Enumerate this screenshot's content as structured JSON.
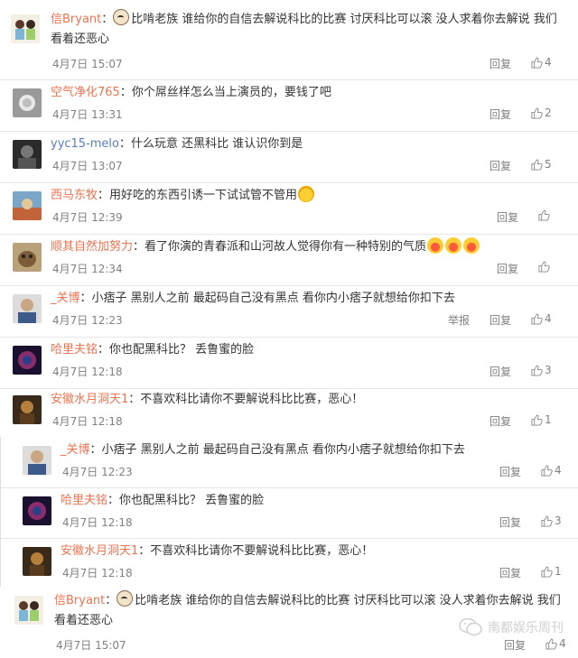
{
  "reply_label": "回复",
  "report_label": "举报",
  "watermark": "南都娱乐周刊",
  "comments": [
    {
      "user": "信Bryant",
      "colon": "：",
      "text": "比啃老族 谁给你的自信去解说科比的比赛 讨厌科比可以滚 没人求着你去解说 我们",
      "text2": "看着还恶心",
      "time": "4月7日 15:07",
      "likes": "4"
    },
    {
      "user": "空气净化765",
      "colon": "：",
      "text": "你个屌丝样怎么当上演员的，要钱了吧",
      "time": "4月7日 13:31",
      "likes": "2"
    },
    {
      "user": "yyc15-melo",
      "colon": "：",
      "text": "什么玩意 还黑科比 谁认识你到是",
      "time": "4月7日 13:07",
      "likes": "5"
    },
    {
      "user": "西马东牧",
      "colon": "：",
      "text": "用好吃的东西引诱一下试试管不管用",
      "time": "4月7日 12:39",
      "likes": ""
    },
    {
      "user": "顺其自然加努力",
      "colon": "：",
      "text": "看了你演的青春派和山河故人觉得你有一种特别的气质",
      "time": "4月7日 12:34",
      "likes": ""
    },
    {
      "user": "_关博",
      "colon": "：",
      "text": "小痞子  黑别人之前  最起码自己没有黑点 看你内小痞子就想给你扣下去",
      "time": "4月7日 12:23",
      "likes": "4"
    },
    {
      "user": "哈里夫铭",
      "colon": "：",
      "text": "你也配黑科比？ 丢鲁蜜的脸",
      "time": "4月7日 12:18",
      "likes": "3"
    },
    {
      "user": "安徽水月洞天1",
      "colon": "：",
      "text": "不喜欢科比请你不要解说科比比赛，恶心！",
      "time": "4月7日 12:18",
      "likes": "1"
    },
    {
      "user": "_关博",
      "colon": "：",
      "text": "小痞子  黑别人之前  最起码自己没有黑点 看你内小痞子就想给你扣下去",
      "time": "4月7日 12:23",
      "likes": "4"
    },
    {
      "user": "哈里夫铭",
      "colon": "：",
      "text": "你也配黑科比？ 丢鲁蜜的脸",
      "time": "4月7日 12:18",
      "likes": "3"
    },
    {
      "user": "安徽水月洞天1",
      "colon": "：",
      "text": "不喜欢科比请你不要解说科比比赛，恶心！",
      "time": "4月7日 12:18",
      "likes": "1"
    },
    {
      "user": "信Bryant",
      "colon": "：",
      "text": "比啃老族 谁给你的自信去解说科比的比赛 讨厌科比可以滚 没人求着你去解说 我们",
      "text2": "看着还恶心",
      "time": "4月7日 15:07",
      "likes": "4"
    }
  ]
}
